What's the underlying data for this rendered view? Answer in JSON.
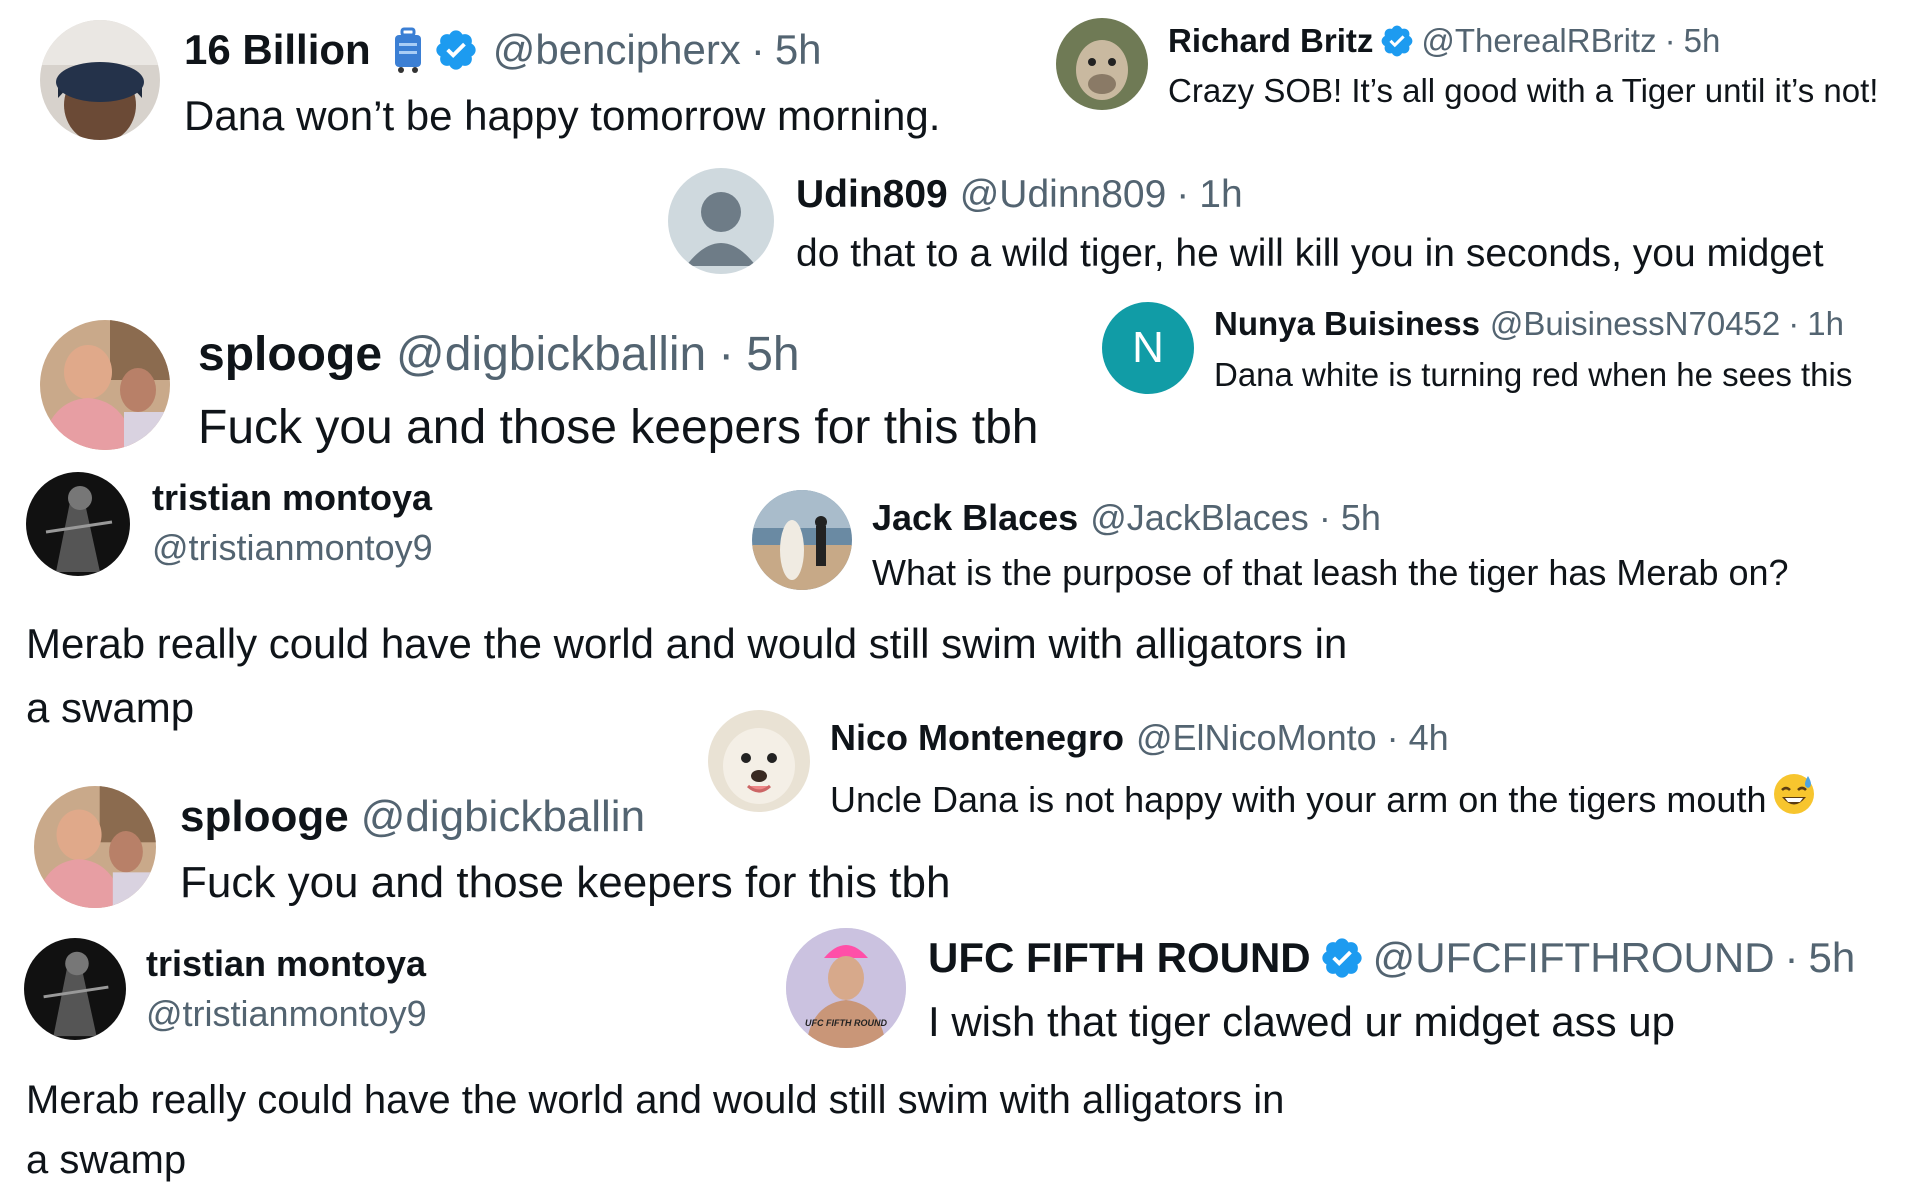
{
  "colors": {
    "verified": "#1d9bf0",
    "handle": "#536471",
    "text": "#0f1419",
    "teal_avatar": "#119ca6"
  },
  "replies": [
    {
      "name": "16 Billion",
      "badge_icon": "luggage-icon",
      "verified": true,
      "handle": "@bencipherx",
      "sep": "·",
      "time": "5h",
      "text": "Dana won’t be happy tomorrow morning."
    },
    {
      "name": "Richard Britz",
      "verified": true,
      "handle": "@TherealRBritz",
      "sep": "·",
      "time": "5h",
      "text": "Crazy SOB! It’s all good with a Tiger until it’s not!"
    },
    {
      "name": "Udin809",
      "handle": "@Udinn809",
      "sep": "·",
      "time": "1h",
      "text": "do that to a wild tiger, he will kill you in seconds, you midget"
    },
    {
      "name": "splooge",
      "handle": "@digbickballin",
      "sep": "·",
      "time": "5h",
      "text": "Fuck you and those keepers for this tbh"
    },
    {
      "name": "Nunya Buisiness",
      "avatar_letter": "N",
      "handle": "@BuisinessN70452",
      "sep": "·",
      "time": "1h",
      "text": "Dana white is turning red when he sees this"
    },
    {
      "name": "tristian montoya",
      "handle": "@tristianmontoy9",
      "text_line1": "Merab really could have the world and would still swim  with alligators in",
      "text_line2": "a swamp"
    },
    {
      "name": "Jack Blaces",
      "handle": "@JackBlaces",
      "sep": "·",
      "time": "5h",
      "text": "What is the purpose of that leash the tiger has Merab on?"
    },
    {
      "name": "Nico Montenegro",
      "handle": "@ElNicoMonto",
      "sep": "·",
      "time": "4h",
      "text": "Uncle Dana is not happy with your arm on the tigers mouth",
      "emoji_icon": "sweat-smile-emoji-icon"
    },
    {
      "name": "splooge",
      "handle": "@digbickballin",
      "text": "Fuck you and those keepers for this tbh"
    },
    {
      "name": "tristian montoya",
      "handle": "@tristianmontoy9",
      "text_line1": "Merab really could have the world and would still swim  with alligators in",
      "text_line2": "a swamp"
    },
    {
      "name": "UFC FIFTH ROUND",
      "verified": true,
      "handle": "@UFCFIFTHROUND",
      "sep": "·",
      "time": "5h",
      "text": "I wish that tiger clawed ur midget ass up",
      "avatar_text": "UFC FIFTH ROUND"
    }
  ]
}
